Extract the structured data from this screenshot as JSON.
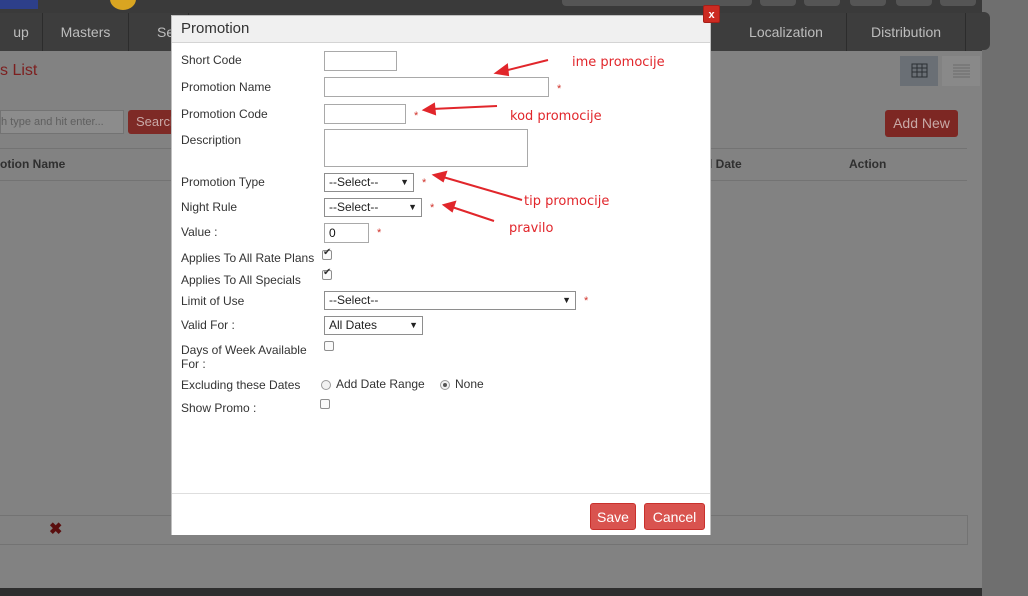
{
  "nav": {
    "items": [
      "up",
      "Masters",
      "Se",
      "Localization",
      "Distribution"
    ]
  },
  "page": {
    "title": "s List"
  },
  "toolbar": {
    "search_placeholder": "h type and hit enter...",
    "search_label": "Search",
    "add_new_label": "Add New"
  },
  "table": {
    "columns": [
      "otion Name",
      "d Date",
      "Action"
    ]
  },
  "modal": {
    "title": "Promotion",
    "close_label": "x",
    "fields": {
      "short_code": {
        "label": "Short Code",
        "value": ""
      },
      "promotion_name": {
        "label": "Promotion Name",
        "value": "",
        "required": "*"
      },
      "promotion_code": {
        "label": "Promotion Code",
        "value": "",
        "required": "*"
      },
      "description": {
        "label": "Description",
        "value": ""
      },
      "promotion_type": {
        "label": "Promotion Type",
        "selected": "--Select--",
        "required": "*"
      },
      "night_rule": {
        "label": "Night Rule",
        "selected": "--Select--",
        "required": "*"
      },
      "value": {
        "label": "Value :",
        "value": "0",
        "required": "*"
      },
      "applies_rate_plans": {
        "label": "Applies To All Rate Plans",
        "checked": true
      },
      "applies_specials": {
        "label": "Applies To All Specials",
        "checked": true
      },
      "limit_of_use": {
        "label": "Limit of Use",
        "selected": "--Select--",
        "required": "*"
      },
      "valid_for": {
        "label": "Valid For :",
        "selected": "All Dates"
      },
      "days_of_week": {
        "label_line1": "Days of Week Available",
        "label_line2": "For :",
        "checked": false
      },
      "excluding_dates": {
        "label": "Excluding these Dates",
        "option_add": "Add Date Range",
        "option_none": "None",
        "selected": "None"
      },
      "show_promo": {
        "label": "Show Promo :",
        "checked": false
      }
    },
    "save_label": "Save",
    "cancel_label": "Cancel"
  },
  "annotations": {
    "name": "ime promocije",
    "code": "kod promocije",
    "type": "tip promocije",
    "rule": "pravilo",
    "color": "#e1262b"
  },
  "icons": {
    "grid_view": "grid-icon",
    "list_view": "list-icon",
    "delete": "x-mark-icon"
  }
}
